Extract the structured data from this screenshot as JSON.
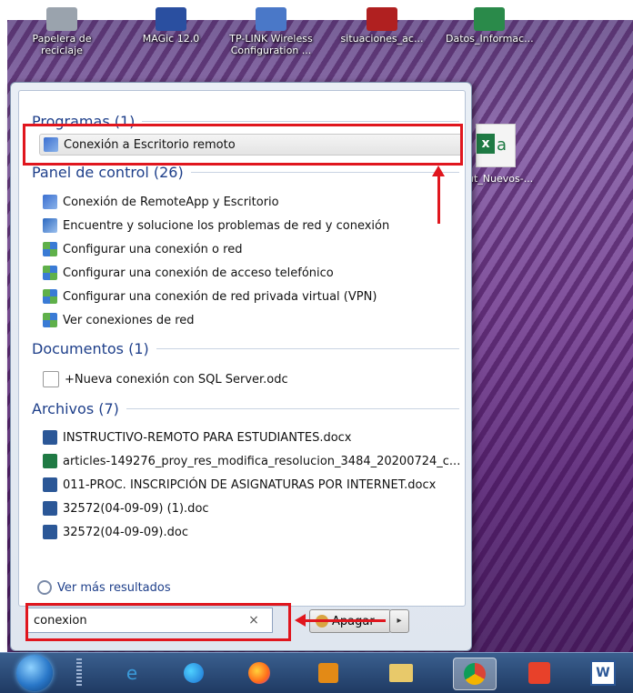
{
  "desktop": {
    "icons": [
      {
        "label": "Papelera de reciclaje",
        "color": "#9aa3ad"
      },
      {
        "label": "MAGic 12.0",
        "color": "#2a4fa0"
      },
      {
        "label": "TP-LINK Wireless Configuration ...",
        "color": "#4a78c8"
      },
      {
        "label": "situaciones_ac...",
        "color": "#b02020"
      },
      {
        "label": "Datos_Informac...",
        "color": "#2a8a4a"
      }
    ],
    "excel_icon_label": "ut_Nuevos-..."
  },
  "start_menu": {
    "sections": {
      "programs": "Programas (1)",
      "control_panel": "Panel de control (26)",
      "documents": "Documentos (1)",
      "files": "Archivos (7)"
    },
    "programs": [
      "Conexión a Escritorio remoto"
    ],
    "control_panel": [
      "Conexión de RemoteApp y Escritorio",
      "Encuentre y solucione los problemas de red y conexión",
      "Configurar una conexión o red",
      "Configurar una conexión de acceso telefónico",
      "Configurar una conexión de red privada virtual (VPN)",
      "Ver conexiones de red"
    ],
    "documents": [
      "+Nueva conexión con SQL Server.odc"
    ],
    "files": [
      "INSTRUCTIVO-REMOTO PARA ESTUDIANTES.docx",
      "articles-149276_proy_res_modifica_resolucion_3484_20200724_c...",
      "011-PROC. INSCRIPCIÓN DE ASIGNATURAS POR INTERNET.docx",
      "32572(04-09-09) (1).doc",
      "32572(04-09-09).doc"
    ],
    "more_results": "Ver más resultados",
    "search": {
      "value": "conexion",
      "clear": "×"
    },
    "shutdown_label": "Apagar",
    "shutdown_arrow": "▸"
  },
  "colors": {
    "highlight": "#e0161e",
    "heading": "#1e3f8a"
  }
}
